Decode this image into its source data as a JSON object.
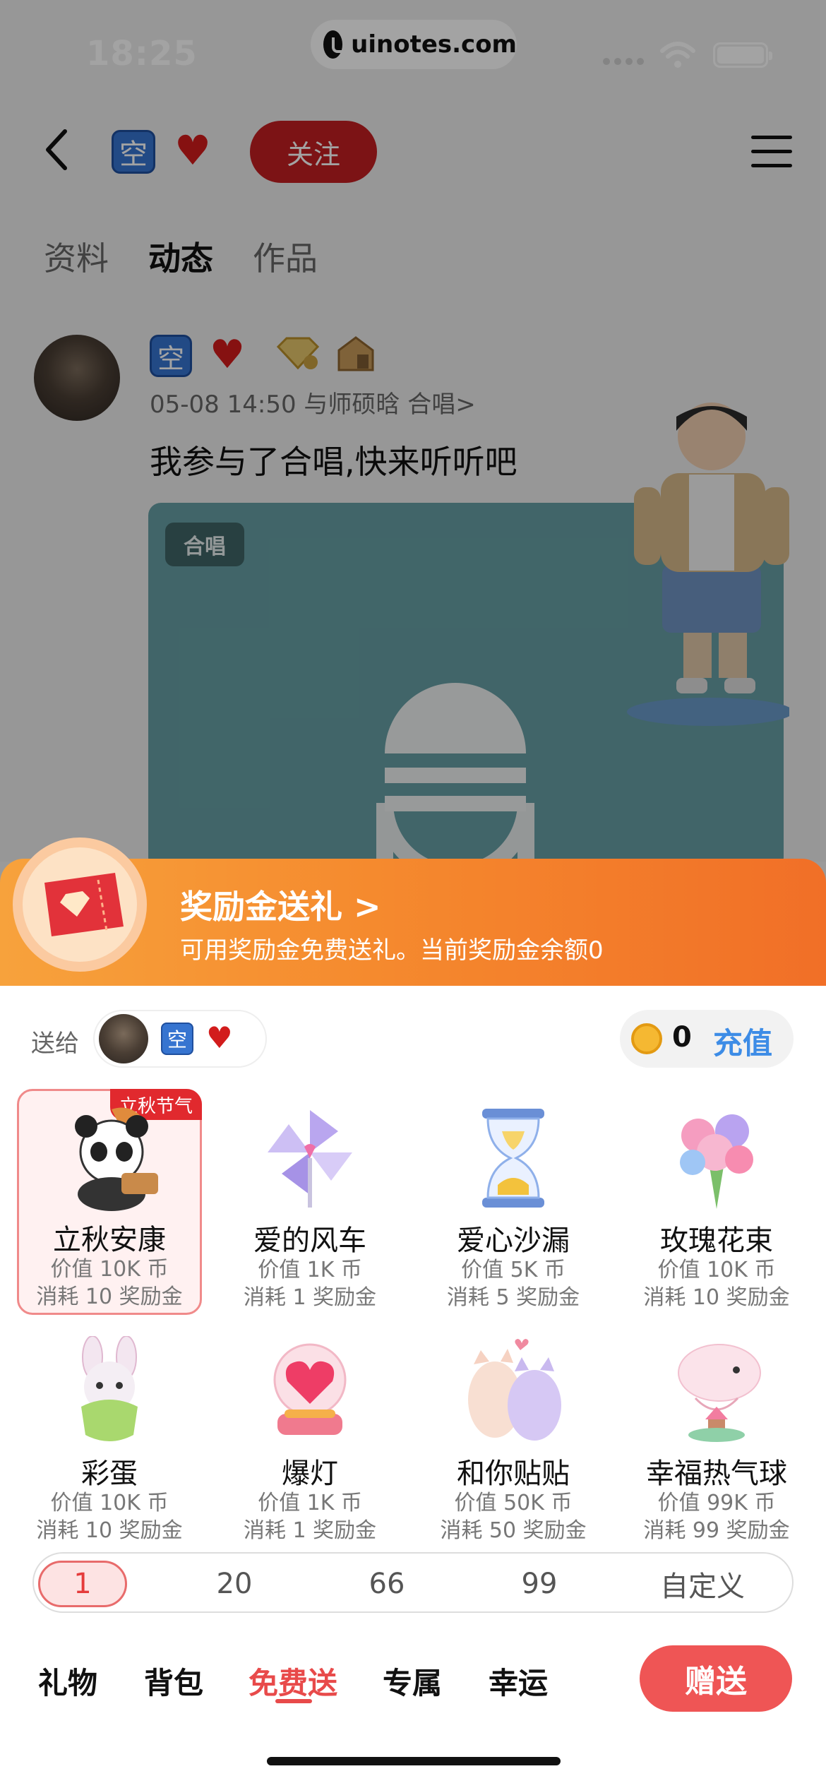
{
  "status_bar": {
    "time": "18:25",
    "url": "uinotes.com"
  },
  "nav": {
    "badge": "空",
    "follow_label": "关注"
  },
  "profile_tabs": [
    {
      "label": "资料",
      "active": false
    },
    {
      "label": "动态",
      "active": true
    },
    {
      "label": "作品",
      "active": false
    }
  ],
  "post": {
    "badge": "空",
    "meta": "05-08 14:50  与师硕晗 合唱>",
    "text": "我参与了合唱,快来听听吧",
    "card_tag": "合唱"
  },
  "reward_banner": {
    "title": "奖励金送礼 >",
    "subtitle": "可用奖励金免费送礼。当前奖励金余额0"
  },
  "send_to": {
    "label": "送给",
    "badge": "空"
  },
  "wallet": {
    "coins": "0",
    "recharge_label": "充值"
  },
  "gifts": [
    {
      "name": "立秋安康",
      "price": "价值 10K 币",
      "cost": "消耗 10 奖励金",
      "badge": "立秋节气",
      "selected": true,
      "icon": "panda-icon"
    },
    {
      "name": "爱的风车",
      "price": "价值 1K 币",
      "cost": "消耗 1 奖励金",
      "icon": "pinwheel-icon"
    },
    {
      "name": "爱心沙漏",
      "price": "价值 5K 币",
      "cost": "消耗 5 奖励金",
      "icon": "hourglass-icon"
    },
    {
      "name": "玫瑰花束",
      "price": "价值 10K 币",
      "cost": "消耗 10 奖励金",
      "icon": "bouquet-icon"
    },
    {
      "name": "彩蛋",
      "price": "价值 10K 币",
      "cost": "消耗 10 奖励金",
      "icon": "bunny-egg-icon"
    },
    {
      "name": "爆灯",
      "price": "价值 1K 币",
      "cost": "消耗 1 奖励金",
      "icon": "heart-lamp-icon"
    },
    {
      "name": "和你贴贴",
      "price": "价值 50K 币",
      "cost": "消耗 50 奖励金",
      "icon": "cats-icon"
    },
    {
      "name": "幸福热气球",
      "price": "价值 99K 币",
      "cost": "消耗 99 奖励金",
      "icon": "balloon-icon"
    }
  ],
  "quantities": [
    {
      "label": "1",
      "selected": true
    },
    {
      "label": "20"
    },
    {
      "label": "66"
    },
    {
      "label": "99"
    },
    {
      "label": "自定义"
    }
  ],
  "bottom_tabs": [
    {
      "label": "礼物"
    },
    {
      "label": "背包"
    },
    {
      "label": "免费送",
      "active": true
    },
    {
      "label": "专属"
    },
    {
      "label": "幸运"
    }
  ],
  "send_button_label": "赠送",
  "colors": {
    "accent_red": "#ef5555",
    "reward_orange": "#f58a2e",
    "recharge_blue": "#3d8ce6"
  }
}
